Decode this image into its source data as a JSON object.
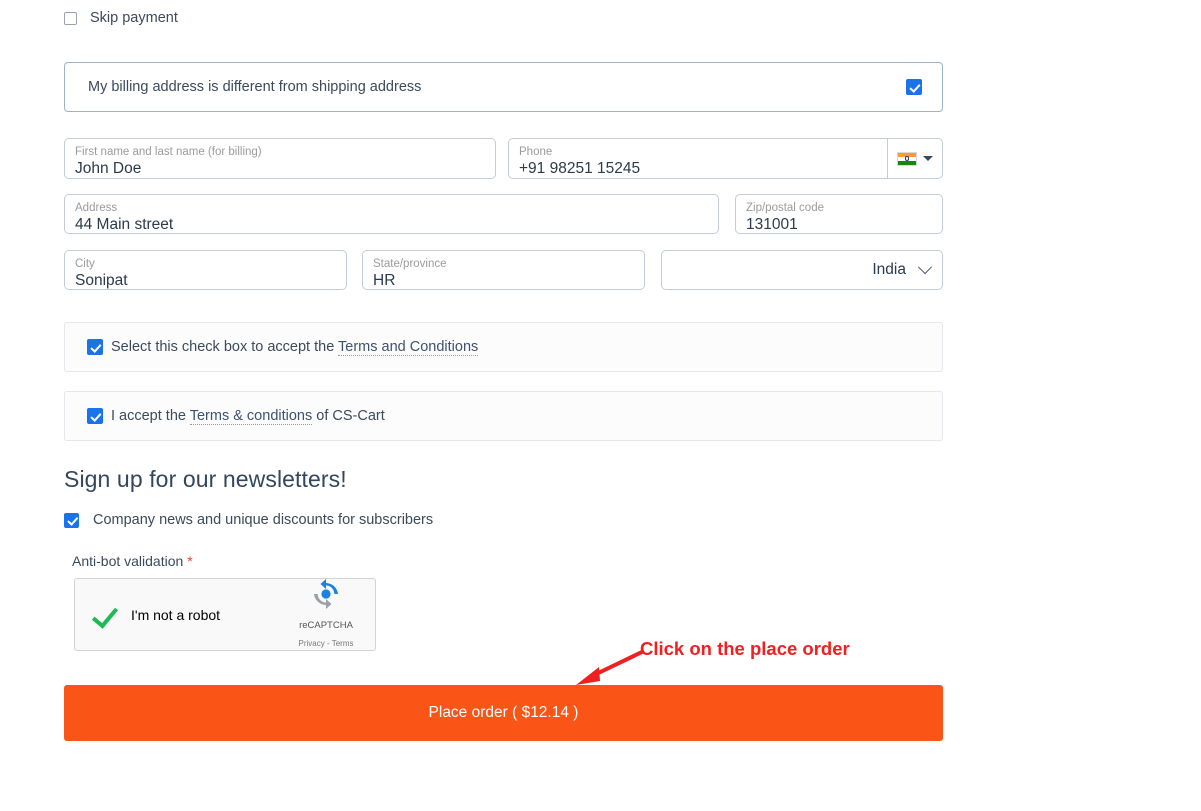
{
  "skip_payment": {
    "label": "Skip payment",
    "checked": false
  },
  "billing": {
    "notice": "My billing address is different from shipping address",
    "checked": true
  },
  "form": {
    "name": {
      "label": "First name and last name (for billing)",
      "value": "John Doe"
    },
    "phone": {
      "label": "Phone",
      "value": "+91 98251 15245",
      "flag_icon": "india-flag-icon"
    },
    "address": {
      "label": "Address",
      "value": "44 Main street"
    },
    "zip": {
      "label": "Zip/postal code",
      "value": "131001"
    },
    "city": {
      "label": "City",
      "value": "Sonipat"
    },
    "state": {
      "label": "State/province",
      "value": "HR"
    },
    "country": {
      "value": "India"
    }
  },
  "terms": {
    "first": {
      "prefix": "Select this check box to accept the ",
      "link": "Terms and Conditions",
      "suffix": "",
      "checked": true
    },
    "second": {
      "prefix": "I accept the ",
      "link": "Terms & conditions",
      "suffix": " of CS-Cart",
      "checked": true
    }
  },
  "newsletter": {
    "title": "Sign up for our newsletters!",
    "subscribe_label": "Company news and unique discounts for subscribers",
    "checked": true
  },
  "antibot": {
    "label": "Anti-bot validation",
    "required_mark": "*"
  },
  "recaptcha": {
    "checkbox_label": "I'm not a robot",
    "brand": "reCAPTCHA",
    "legal": "Privacy - Terms",
    "verified": true
  },
  "annotation": {
    "text": "Click on the place order",
    "color": "#ef2020"
  },
  "place_order": {
    "label": "Place order ( $12.14 )",
    "color": "#fa5516"
  }
}
